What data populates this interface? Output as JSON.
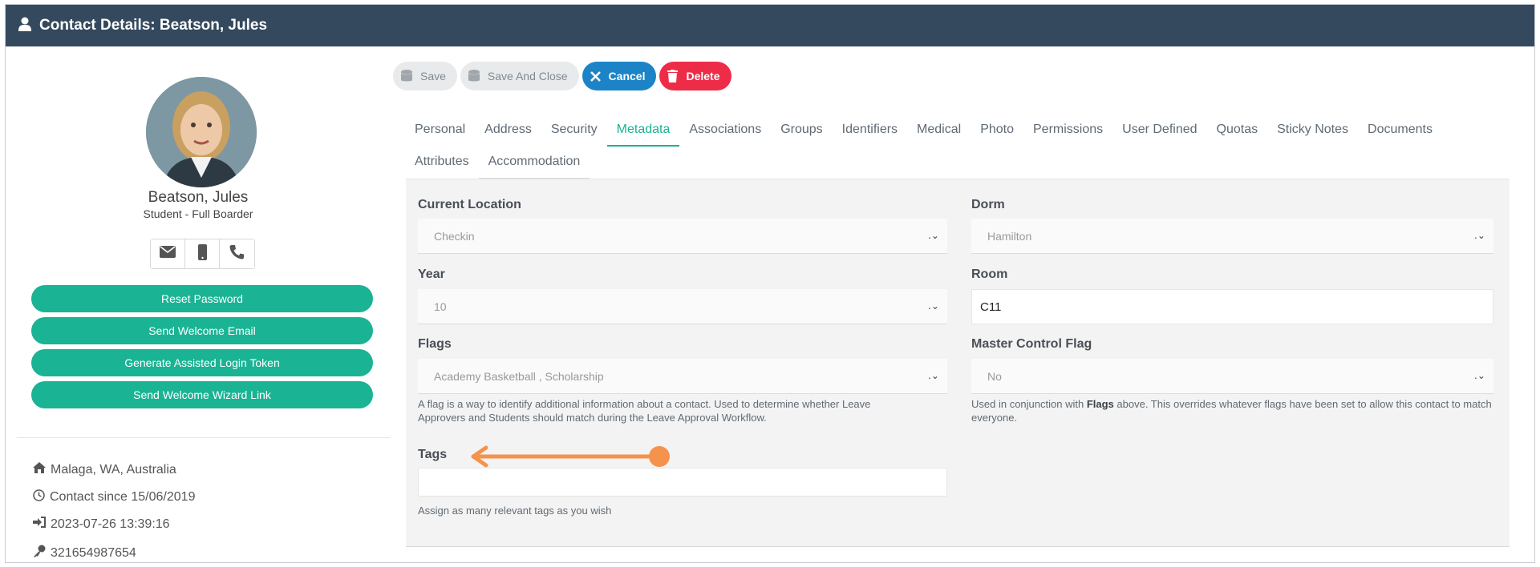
{
  "window": {
    "title": "Contact Details: Beatson, Jules"
  },
  "profile": {
    "name": "Beatson, Jules",
    "role": "Student - Full Boarder",
    "contact_icons": [
      "envelope-icon",
      "mobile-icon",
      "phone-icon"
    ]
  },
  "actions": {
    "reset_password": "Reset Password",
    "send_welcome_email": "Send Welcome Email",
    "generate_token": "Generate Assisted Login Token",
    "send_wizard_link": "Send Welcome Wizard Link"
  },
  "info": {
    "location": "Malaga, WA, Australia",
    "contact_since": "Contact since 15/06/2019",
    "last_login": "2023-07-26 13:39:16",
    "key_id": "321654987654"
  },
  "toolbar": {
    "save": "Save",
    "save_and_close": "Save And Close",
    "cancel": "Cancel",
    "delete": "Delete"
  },
  "tabs": {
    "row1": [
      "Personal",
      "Address",
      "Security",
      "Metadata",
      "Associations",
      "Groups",
      "Identifiers",
      "Medical",
      "Photo",
      "Permissions",
      "User Defined",
      "Quotas",
      "Sticky Notes",
      "Documents"
    ],
    "row2": [
      "Attributes",
      "Accommodation"
    ],
    "active": "Metadata"
  },
  "form": {
    "current_location": {
      "label": "Current Location",
      "value": "Checkin"
    },
    "dorm": {
      "label": "Dorm",
      "value": "Hamilton"
    },
    "year": {
      "label": "Year",
      "value": "10"
    },
    "room": {
      "label": "Room",
      "value": "C11"
    },
    "flags": {
      "label": "Flags",
      "value": "Academy Basketball , Scholarship",
      "help": "A flag is a way to identify additional information about a contact. Used to determine whether Leave Approvers and Students should match during the Leave Approval Workflow."
    },
    "master_control_flag": {
      "label": "Master Control Flag",
      "value": "No",
      "help_pre": "Used in conjunction with ",
      "help_bold": "Flags",
      "help_post": " above. This overrides whatever flags have been set to allow this contact to match everyone."
    },
    "tags": {
      "label": "Tags",
      "value": "",
      "help": "Assign as many relevant tags as you wish"
    }
  },
  "colors": {
    "header": "#34495e",
    "primary_green": "#1ab394",
    "cancel_blue": "#1c84c6",
    "delete_red": "#ed2d48",
    "annotation_orange": "#f5924b"
  }
}
